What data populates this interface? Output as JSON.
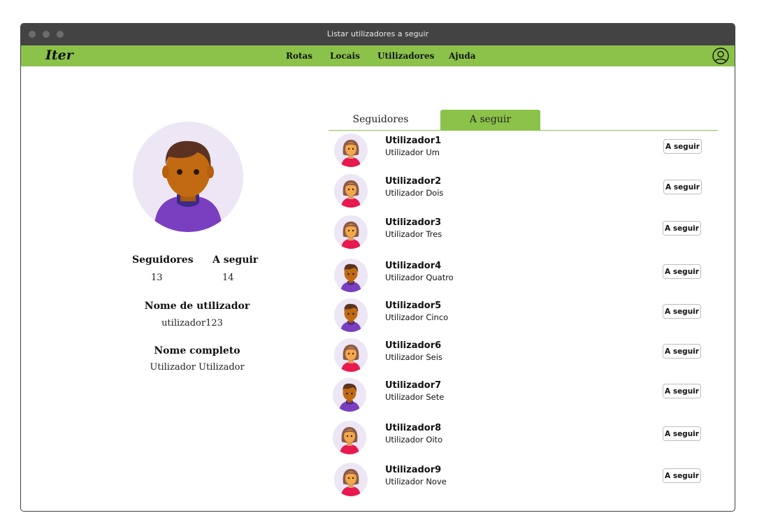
{
  "window": {
    "title": "Listar utilizadores a seguir"
  },
  "nav": {
    "logo": "Iter",
    "links": [
      "Rotas",
      "Locais",
      "Utilizadores",
      "Ajuda"
    ]
  },
  "colors": {
    "accent": "#8bc34a",
    "titlebar": "#434343",
    "avatar_bg": "#ece6f5"
  },
  "profile": {
    "followers_label": "Seguidores",
    "followers_count": "13",
    "following_label": "A seguir",
    "following_count": "14",
    "username_label": "Nome de utilizador",
    "username": "utilizador123",
    "fullname_label": "Nome completo",
    "fullname": "Utilizador Utilizador"
  },
  "tabs": [
    {
      "label": "Seguidores",
      "active": false
    },
    {
      "label": "A seguir",
      "active": true
    }
  ],
  "users": [
    {
      "username": "Utilizador1",
      "name": "Utilizador Um",
      "avatar": "female",
      "button": "A seguir"
    },
    {
      "username": "Utilizador2",
      "name": "Utilizador Dois",
      "avatar": "female",
      "button": "A seguir"
    },
    {
      "username": "Utilizador3",
      "name": "Utilizador Tres",
      "avatar": "female",
      "button": "A seguir"
    },
    {
      "username": "Utilizador4",
      "name": "Utilizador Quatro",
      "avatar": "male",
      "button": "A seguir"
    },
    {
      "username": "Utilizador5",
      "name": "Utilizador Cinco",
      "avatar": "male",
      "button": "A seguir"
    },
    {
      "username": "Utilizador6",
      "name": "Utilizador Seis",
      "avatar": "female",
      "button": "A seguir"
    },
    {
      "username": "Utilizador7",
      "name": "Utilizador Sete",
      "avatar": "male",
      "button": "A seguir"
    },
    {
      "username": "Utilizador8",
      "name": "Utilizador Oito",
      "avatar": "female",
      "button": "A seguir"
    },
    {
      "username": "Utilizador9",
      "name": "Utilizador Nove",
      "avatar": "female",
      "button": "A seguir"
    }
  ]
}
